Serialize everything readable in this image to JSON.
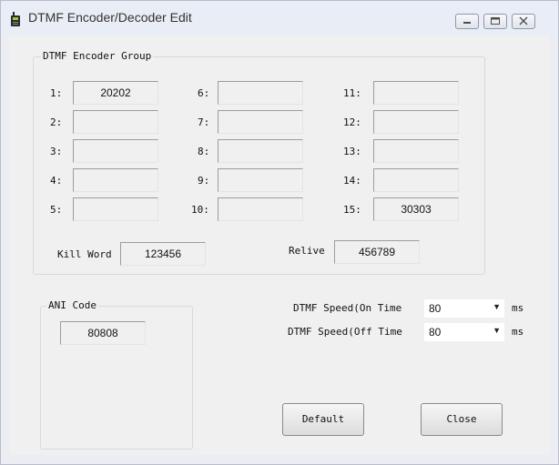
{
  "window": {
    "title": "DTMF Encoder/Decoder Edit",
    "controls": {
      "minimize_icon": "minimize-icon",
      "maximize_icon": "maximize-icon",
      "close_icon": "close-icon"
    }
  },
  "encoder_group": {
    "title": "DTMF Encoder Group",
    "rows": [
      {
        "label": "1:",
        "value": "20202"
      },
      {
        "label": "2:",
        "value": ""
      },
      {
        "label": "3:",
        "value": ""
      },
      {
        "label": "4:",
        "value": ""
      },
      {
        "label": "5:",
        "value": ""
      },
      {
        "label": "6:",
        "value": ""
      },
      {
        "label": "7:",
        "value": ""
      },
      {
        "label": "8:",
        "value": ""
      },
      {
        "label": "9:",
        "value": ""
      },
      {
        "label": "10:",
        "value": ""
      },
      {
        "label": "11:",
        "value": ""
      },
      {
        "label": "12:",
        "value": ""
      },
      {
        "label": "13:",
        "value": ""
      },
      {
        "label": "14:",
        "value": ""
      },
      {
        "label": "15:",
        "value": "30303"
      }
    ],
    "kill_word": {
      "label": "Kill Word",
      "value": "123456"
    },
    "relive": {
      "label": "Relive",
      "value": "456789"
    }
  },
  "ani": {
    "title": "ANI Code",
    "value": "80808"
  },
  "speed": {
    "on_label": "DTMF Speed(On Time",
    "on_value": "80",
    "off_label": "DTMF Speed(Off Time",
    "off_value": "80",
    "unit": "ms"
  },
  "buttons": {
    "default_label": "Default",
    "close_label": "Close"
  }
}
